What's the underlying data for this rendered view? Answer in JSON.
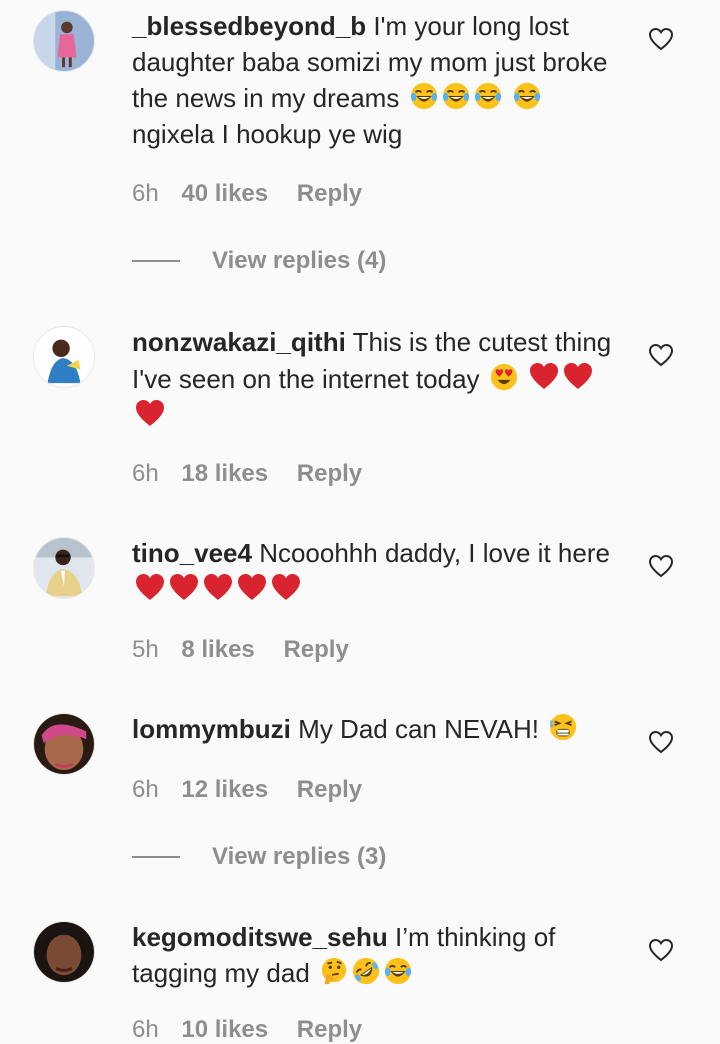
{
  "comments": [
    {
      "username": "_blessedbeyond_b",
      "text": "I'm your long lost daughter baba somizi my mom just broke the news in my dreams",
      "text_after": "ngixela I hookup ye wig",
      "time": "6h",
      "likes": "40 likes",
      "reply": "Reply",
      "view_replies": "View replies (4)"
    },
    {
      "username": "nonzwakazi_qithi",
      "text": "This is the cutest thing I've seen on the internet today",
      "time": "6h",
      "likes": "18 likes",
      "reply": "Reply"
    },
    {
      "username": "tino_vee4",
      "text": "Ncooohhh daddy, I love it here",
      "time": "5h",
      "likes": "8 likes",
      "reply": "Reply"
    },
    {
      "username": "lommymbuzi",
      "text": "My Dad can NEVAH!",
      "time": "6h",
      "likes": "12 likes",
      "reply": "Reply",
      "view_replies": "View replies (3)"
    },
    {
      "username": "kegomoditswe_sehu",
      "text": "I’m thinking of tagging my dad",
      "time": "6h",
      "likes": "10 likes",
      "reply": "Reply"
    }
  ],
  "icons": {
    "like": "heart-outline-icon",
    "emoji_laugh": "face-with-tears-of-joy-icon",
    "emoji_heart_eyes": "smiling-face-with-heart-eyes-icon",
    "emoji_heart": "red-heart-icon",
    "emoji_tired": "tired-face-icon",
    "emoji_thinking": "thinking-face-icon",
    "emoji_rofl": "rolling-on-floor-laughing-icon"
  },
  "colors": {
    "background": "#fafafa",
    "text": "#262626",
    "secondary": "#8e8e8e",
    "heart": "#d9232e"
  }
}
